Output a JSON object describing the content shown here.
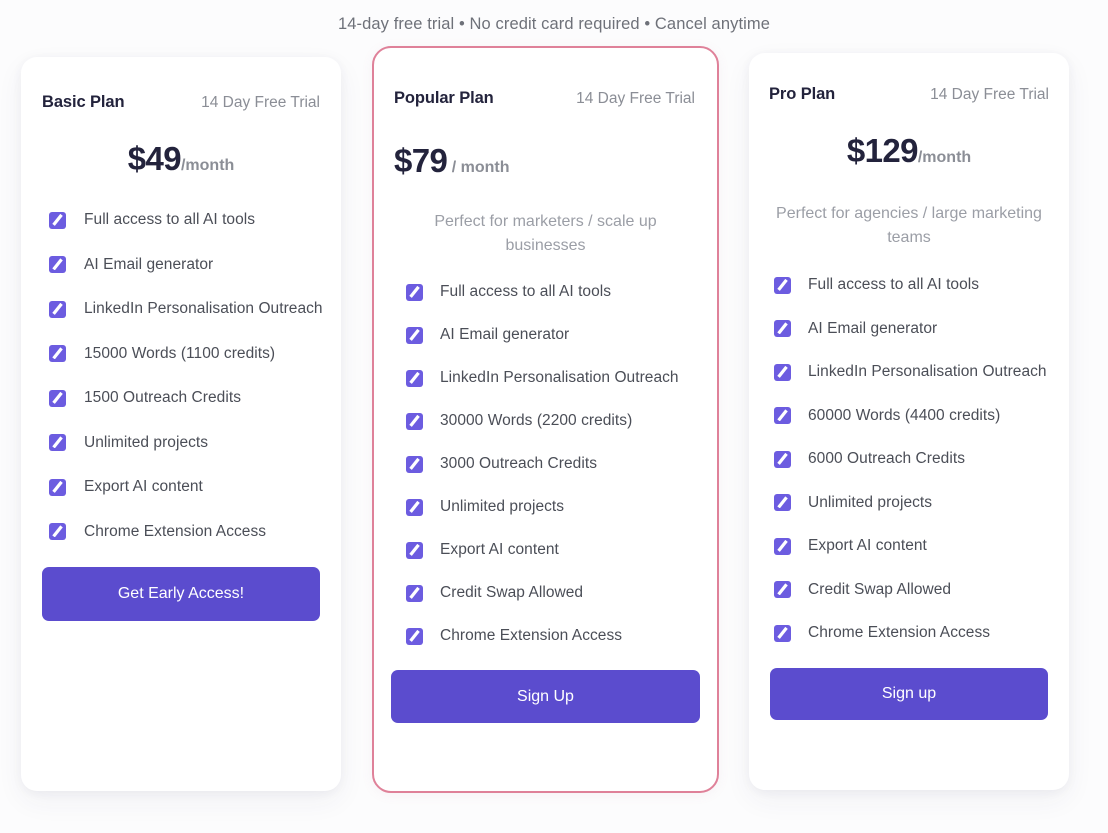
{
  "promo": {
    "text": "14-day free trial • No credit card required • Cancel anytime"
  },
  "theme": {
    "accent": "#5b4cce",
    "bullet": "#6c5ce0",
    "featured_border": "#df8199",
    "heading": "#23233c",
    "muted": "#8b8e96"
  },
  "plans": [
    {
      "name": "Basic Plan",
      "trial": "14 Day Free Trial",
      "price": "$49",
      "period": "/month",
      "subtitle": "",
      "features": [
        "Full access to all AI tools",
        "AI Email generator",
        "LinkedIn Personalisation Outreach",
        "15000 Words (1100 credits)",
        "1500 Outreach Credits",
        "Unlimited projects",
        "Export AI content",
        "Chrome Extension Access"
      ],
      "cta": "Get Early Access!"
    },
    {
      "name": "Popular Plan",
      "trial": "14 Day Free Trial",
      "price": "$79",
      "period": " / month",
      "subtitle": "Perfect for marketers / scale up businesses",
      "features": [
        "Full access to all AI tools",
        "AI Email generator",
        "LinkedIn Personalisation Outreach",
        "30000 Words (2200 credits)",
        "3000 Outreach Credits",
        "Unlimited projects",
        "Export AI content",
        "Credit Swap Allowed",
        "Chrome Extension Access"
      ],
      "cta": "Sign Up"
    },
    {
      "name": "Pro Plan",
      "trial": "14 Day Free Trial",
      "price": "$129",
      "period": "/month",
      "subtitle": "Perfect for agencies / large marketing teams",
      "features": [
        "Full access to all AI tools",
        "AI Email generator",
        "LinkedIn Personalisation Outreach",
        "60000 Words (4400 credits)",
        "6000 Outreach Credits",
        "Unlimited projects",
        "Export AI content",
        "Credit Swap Allowed",
        "Chrome Extension Access"
      ],
      "cta": "Sign up"
    }
  ]
}
